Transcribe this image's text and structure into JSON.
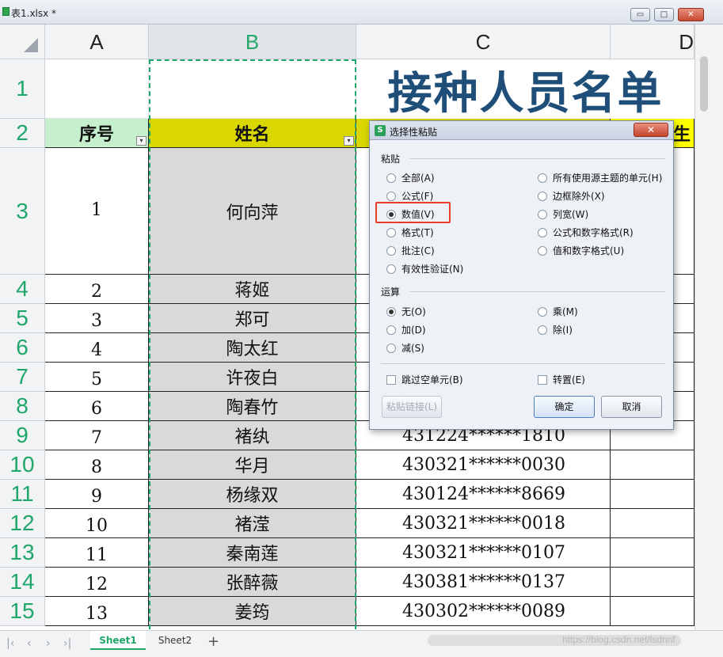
{
  "window": {
    "title": "表1.xlsx *",
    "buttons": {
      "minimize": "▭",
      "restore": "□",
      "close": "✕"
    }
  },
  "columns": [
    "A",
    "B",
    "C",
    "D"
  ],
  "rows": [
    "1",
    "2",
    "3",
    "4",
    "5",
    "6",
    "7",
    "8",
    "9",
    "10",
    "11",
    "12",
    "13",
    "14",
    "15"
  ],
  "sheet": {
    "title": "接种人员名单",
    "headers": {
      "a": "序号",
      "b": "姓名",
      "e": "生"
    },
    "data_rows": [
      {
        "no": "1",
        "name": "何向萍",
        "id": ""
      },
      {
        "no": "2",
        "name": "蒋姬",
        "id": ""
      },
      {
        "no": "3",
        "name": "郑可",
        "id": ""
      },
      {
        "no": "4",
        "name": "陶太红",
        "id": ""
      },
      {
        "no": "5",
        "name": "许夜白",
        "id": ""
      },
      {
        "no": "6",
        "name": "陶春竹",
        "id": ""
      },
      {
        "no": "7",
        "name": "褚纨",
        "id": "431224******1810"
      },
      {
        "no": "8",
        "name": "华月",
        "id": "430321******0030"
      },
      {
        "no": "9",
        "name": "杨缘双",
        "id": "430124******8669"
      },
      {
        "no": "10",
        "name": "褚滢",
        "id": "430321******0018"
      },
      {
        "no": "11",
        "name": "秦南莲",
        "id": "430321******0107"
      },
      {
        "no": "12",
        "name": "张醉薇",
        "id": "430381******0137"
      },
      {
        "no": "13",
        "name": "姜筠",
        "id": "430302******0089"
      }
    ]
  },
  "dialog": {
    "title": "选择性粘贴",
    "close": "✕",
    "paste_label": "粘贴",
    "paste_options_left": [
      "全部(A)",
      "公式(F)",
      "数值(V)",
      "格式(T)",
      "批注(C)",
      "有效性验证(N)"
    ],
    "paste_options_right": [
      "所有使用源主题的单元(H)",
      "边框除外(X)",
      "列宽(W)",
      "公式和数字格式(R)",
      "值和数字格式(U)"
    ],
    "paste_selected": "数值(V)",
    "operation_label": "运算",
    "operation_options_left": [
      "无(O)",
      "加(D)",
      "减(S)"
    ],
    "operation_options_right": [
      "乘(M)",
      "除(I)"
    ],
    "operation_selected": "无(O)",
    "skip_blanks": "跳过空单元(B)",
    "transpose": "转置(E)",
    "paste_link": "粘贴链接(L)",
    "ok": "确定",
    "cancel": "取消"
  },
  "tabs": [
    "Sheet1",
    "Sheet2"
  ],
  "active_tab": "Sheet1",
  "add_tab": "+",
  "watermark": "https://blog.csdn.net/lsdnnf",
  "colors": {
    "accent_green": "#1fa66a",
    "header_yellow": "#d9d600",
    "header_green": "#c6efce",
    "title_blue": "#1f4e79",
    "name_fill": "#d9d9d9",
    "highlight_red": "#e53c2e"
  }
}
